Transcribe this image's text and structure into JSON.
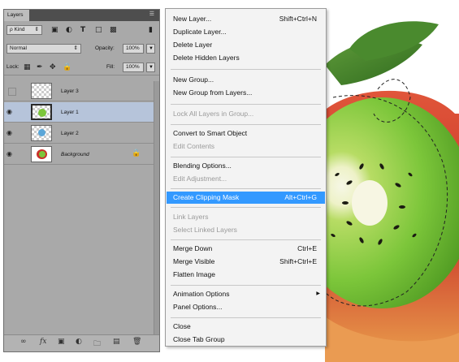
{
  "panel": {
    "tab_label": "Layers",
    "panel_menu_icon": "panel-menu-icon",
    "filter": {
      "kind_label": "ρ Kind",
      "icons": [
        "image-filter-icon",
        "adjustment-filter-icon",
        "type-filter-icon",
        "shape-filter-icon",
        "smart-object-filter-icon"
      ]
    },
    "blend_mode": "Normal",
    "opacity_label": "Opacity:",
    "opacity_value": "100%",
    "lock_label": "Lock:",
    "fill_label": "Fill:",
    "fill_value": "100%",
    "layers": [
      {
        "name": "Layer 3",
        "visible": false,
        "selected": false
      },
      {
        "name": "Layer 1",
        "visible": true,
        "selected": true
      },
      {
        "name": "Layer 2",
        "visible": true,
        "selected": false
      },
      {
        "name": "Background",
        "visible": true,
        "selected": false,
        "locked": true
      }
    ],
    "footer_icons": [
      "link-layers-icon",
      "fx-icon",
      "add-mask-icon",
      "adjustment-layer-icon",
      "new-group-icon",
      "new-layer-icon",
      "delete-layer-icon"
    ],
    "fx_text": "fx"
  },
  "menu": {
    "items": [
      {
        "label": "New Layer...",
        "shortcut": "Shift+Ctrl+N"
      },
      {
        "label": "Duplicate Layer...",
        "shortcut": ""
      },
      {
        "label": "Delete Layer",
        "shortcut": ""
      },
      {
        "label": "Delete Hidden Layers",
        "shortcut": ""
      },
      {
        "label": "New Group...",
        "shortcut": ""
      },
      {
        "label": "New Group from Layers...",
        "shortcut": ""
      },
      {
        "label": "Lock All Layers in Group...",
        "shortcut": "",
        "disabled": true
      },
      {
        "label": "Convert to Smart Object",
        "shortcut": ""
      },
      {
        "label": "Edit Contents",
        "shortcut": "",
        "disabled": true
      },
      {
        "label": "Blending Options...",
        "shortcut": ""
      },
      {
        "label": "Edit Adjustment...",
        "shortcut": "",
        "disabled": true
      },
      {
        "label": "Create Clipping Mask",
        "shortcut": "Alt+Ctrl+G",
        "highlighted": true
      },
      {
        "label": "Link Layers",
        "shortcut": "",
        "disabled": true
      },
      {
        "label": "Select Linked Layers",
        "shortcut": "",
        "disabled": true
      },
      {
        "label": "Merge Down",
        "shortcut": "Ctrl+E"
      },
      {
        "label": "Merge Visible",
        "shortcut": "Shift+Ctrl+E"
      },
      {
        "label": "Flatten Image",
        "shortcut": ""
      },
      {
        "label": "Animation Options",
        "shortcut": "",
        "submenu": true
      },
      {
        "label": "Panel Options...",
        "shortcut": ""
      },
      {
        "label": "Close",
        "shortcut": ""
      },
      {
        "label": "Close Tab Group",
        "shortcut": ""
      }
    ]
  },
  "colors": {
    "panel_bg": "#a9a9a9",
    "selected_layer": "#b6c4da",
    "menu_highlight": "#3399ff",
    "kiwi_green": "#7cc63a",
    "apple_red": "#c9322a"
  }
}
